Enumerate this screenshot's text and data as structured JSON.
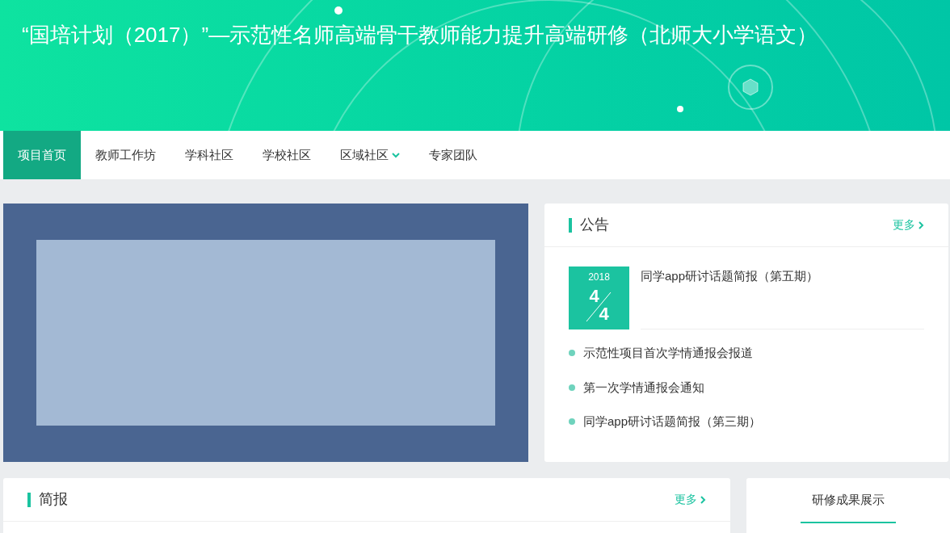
{
  "header": {
    "title": "“国培计划（2017）”—示范性名师高端骨干教师能力提升高端研修（北师大小学语文）"
  },
  "nav": [
    {
      "label": "项目首页",
      "selected": true,
      "dropdown": false
    },
    {
      "label": "教师工作坊",
      "selected": false,
      "dropdown": false
    },
    {
      "label": "学科社区",
      "selected": false,
      "dropdown": false
    },
    {
      "label": "学校社区",
      "selected": false,
      "dropdown": false
    },
    {
      "label": "区域社区",
      "selected": false,
      "dropdown": true
    },
    {
      "label": "专家团队",
      "selected": false,
      "dropdown": false
    }
  ],
  "notice": {
    "title": "公告",
    "more": "更多",
    "featured": {
      "year": "2018",
      "month": "4",
      "day": "4",
      "title": "同学app研讨话题简报（第五期）"
    },
    "items": [
      "示范性项目首次学情通报会报道",
      "第一次学情通报会通知",
      "同学app研讨话题简报（第三期）"
    ]
  },
  "briefing": {
    "title": "简报",
    "more": "更多"
  },
  "results": {
    "tabs": [
      {
        "label": "研修成果展示",
        "selected": true
      }
    ]
  }
}
